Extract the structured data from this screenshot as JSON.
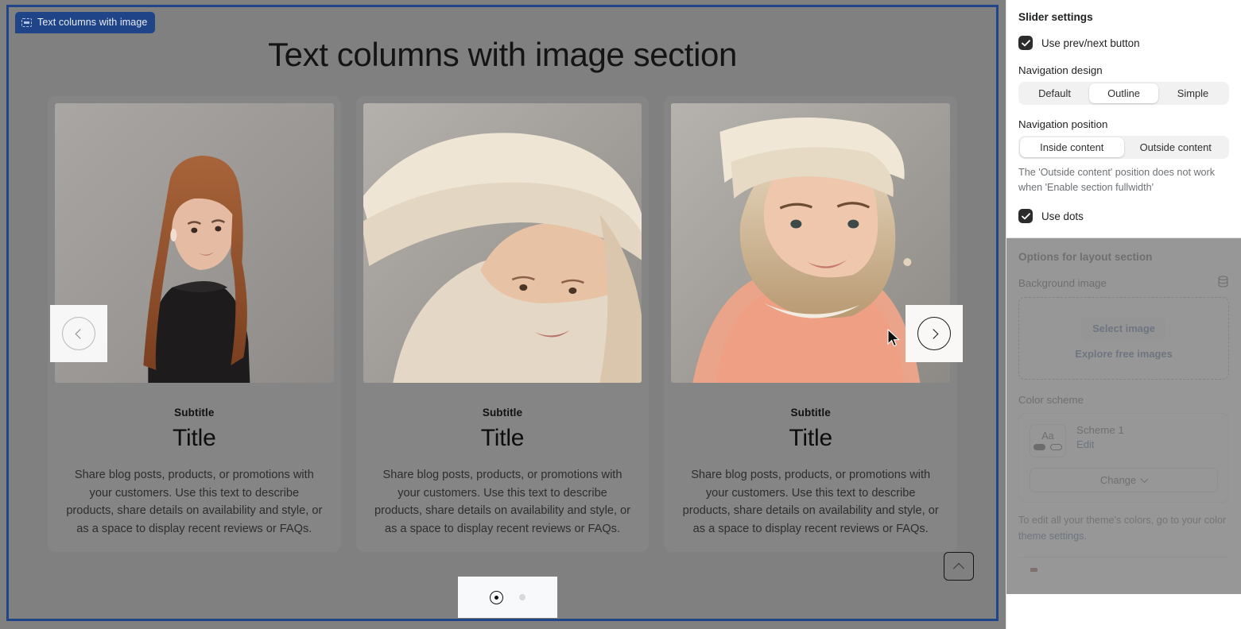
{
  "section_label": {
    "text": "Text columns with image",
    "icon": "section-icon"
  },
  "preview": {
    "heading": "Text columns with image section",
    "cards": [
      {
        "subtitle": "Subtitle",
        "title": "Title",
        "body": "Share blog posts, products, or promotions with your customers. Use this text to describe products, share details on availability and style, or as a space to display recent reviews or FAQs."
      },
      {
        "subtitle": "Subtitle",
        "title": "Title",
        "body": "Share blog posts, products, or promotions with your customers. Use this text to describe products, share details on availability and style, or as a space to display recent reviews or FAQs."
      },
      {
        "subtitle": "Subtitle",
        "title": "Title",
        "body": "Share blog posts, products, or promotions with your customers. Use this text to describe products, share details on availability and style, or as a space to display recent reviews or FAQs."
      }
    ],
    "nav": {
      "prev_icon": "chevron-left-icon",
      "next_icon": "chevron-right-icon",
      "dots_count": 2,
      "active_dot": 1
    },
    "scroll_top_icon": "chevron-up-icon"
  },
  "sidebar": {
    "slider_settings": {
      "title": "Slider settings",
      "use_prev_next": {
        "label": "Use prev/next button",
        "checked": true
      },
      "navigation_design": {
        "label": "Navigation design",
        "options": [
          "Default",
          "Outline",
          "Simple"
        ],
        "selected": "Outline"
      },
      "navigation_position": {
        "label": "Navigation position",
        "options": [
          "Inside content",
          "Outside content"
        ],
        "selected": "Inside content",
        "helper": "The 'Outside content' position does not work when 'Enable section fullwidth'"
      },
      "use_dots": {
        "label": "Use dots",
        "checked": true
      }
    },
    "layout_options": {
      "title": "Options for layout section",
      "background_image": {
        "label": "Background image",
        "source_icon": "database-icon",
        "select_button": "Select image",
        "explore_link": "Explore free images"
      },
      "color_scheme": {
        "label": "Color scheme",
        "swatch_text": "Aa",
        "name": "Scheme 1",
        "edit_link": "Edit",
        "change_button": "Change",
        "change_icon": "chevron-down-icon",
        "note_prefix": "To edit all your theme's colors, go to your color ",
        "note_link": "theme settings",
        "note_suffix": "."
      }
    }
  },
  "colors": {
    "accent_blue": "#1f4488",
    "frame_border": "#1f4488",
    "overlay_gray": "#808080",
    "checkbox_dark": "#2c2c2c"
  }
}
